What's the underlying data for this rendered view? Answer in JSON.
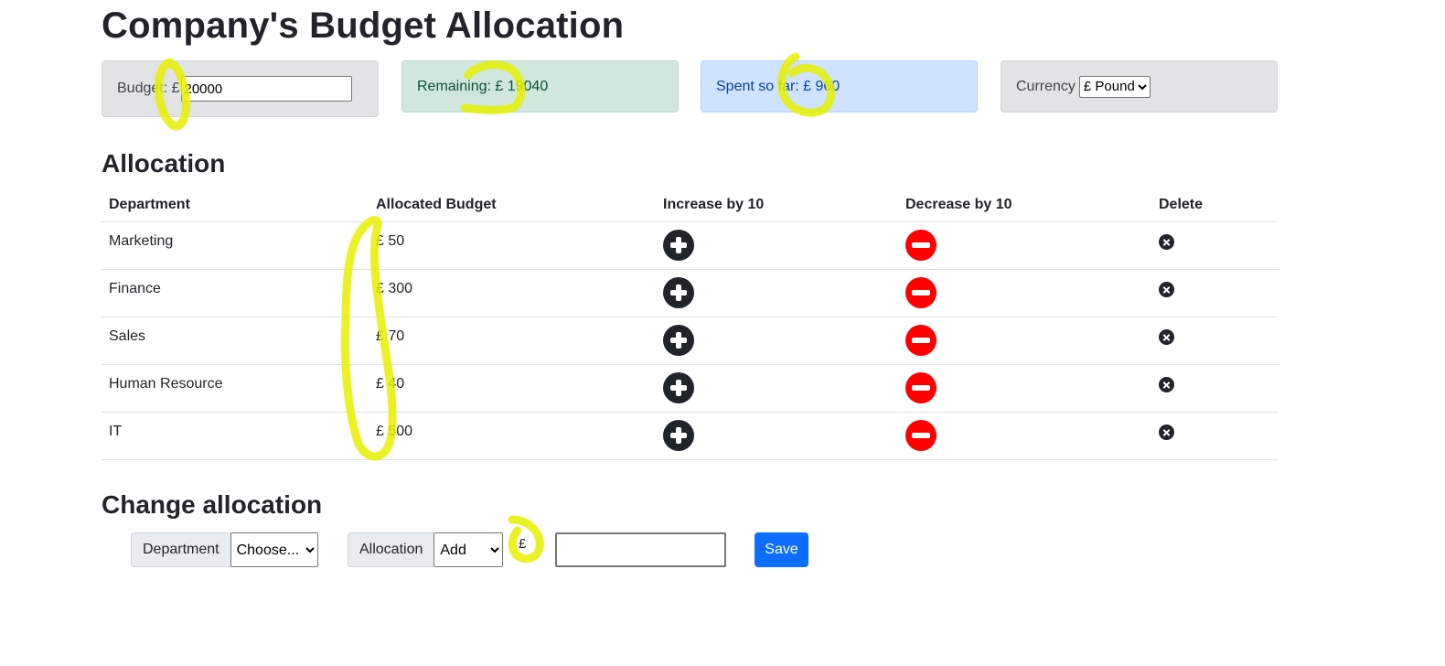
{
  "page": {
    "title": "Company's Budget Allocation"
  },
  "summary": {
    "budget_label": "Budget: £",
    "budget_value": "20000",
    "remaining_text": "Remaining: £ 19040",
    "spent_text": "Spent so far: £ 960",
    "currency_label": "Currency",
    "currency_selected": "£ Pound"
  },
  "allocation": {
    "heading": "Allocation",
    "columns": [
      "Department",
      "Allocated Budget",
      "Increase by 10",
      "Decrease by 10",
      "Delete"
    ],
    "rows": [
      {
        "department": "Marketing",
        "budget": "£ 50"
      },
      {
        "department": "Finance",
        "budget": "£ 300"
      },
      {
        "department": "Sales",
        "budget": "£ 70"
      },
      {
        "department": "Human Resource",
        "budget": "£ 40"
      },
      {
        "department": "IT",
        "budget": "£ 500"
      }
    ]
  },
  "change": {
    "heading": "Change allocation",
    "department_label": "Department",
    "department_selected": "Choose...",
    "allocation_label": "Allocation",
    "allocation_selected": "Add",
    "currency_symbol": "£",
    "amount_value": "",
    "save_label": "Save"
  },
  "colors": {
    "annotation": "#e6f000",
    "increase": "#212529",
    "decrease": "#ff0000",
    "save": "#0d6efd"
  },
  "icons": {
    "increase": "plus-circle-icon",
    "decrease": "minus-circle-icon",
    "delete": "x-circle-icon"
  }
}
